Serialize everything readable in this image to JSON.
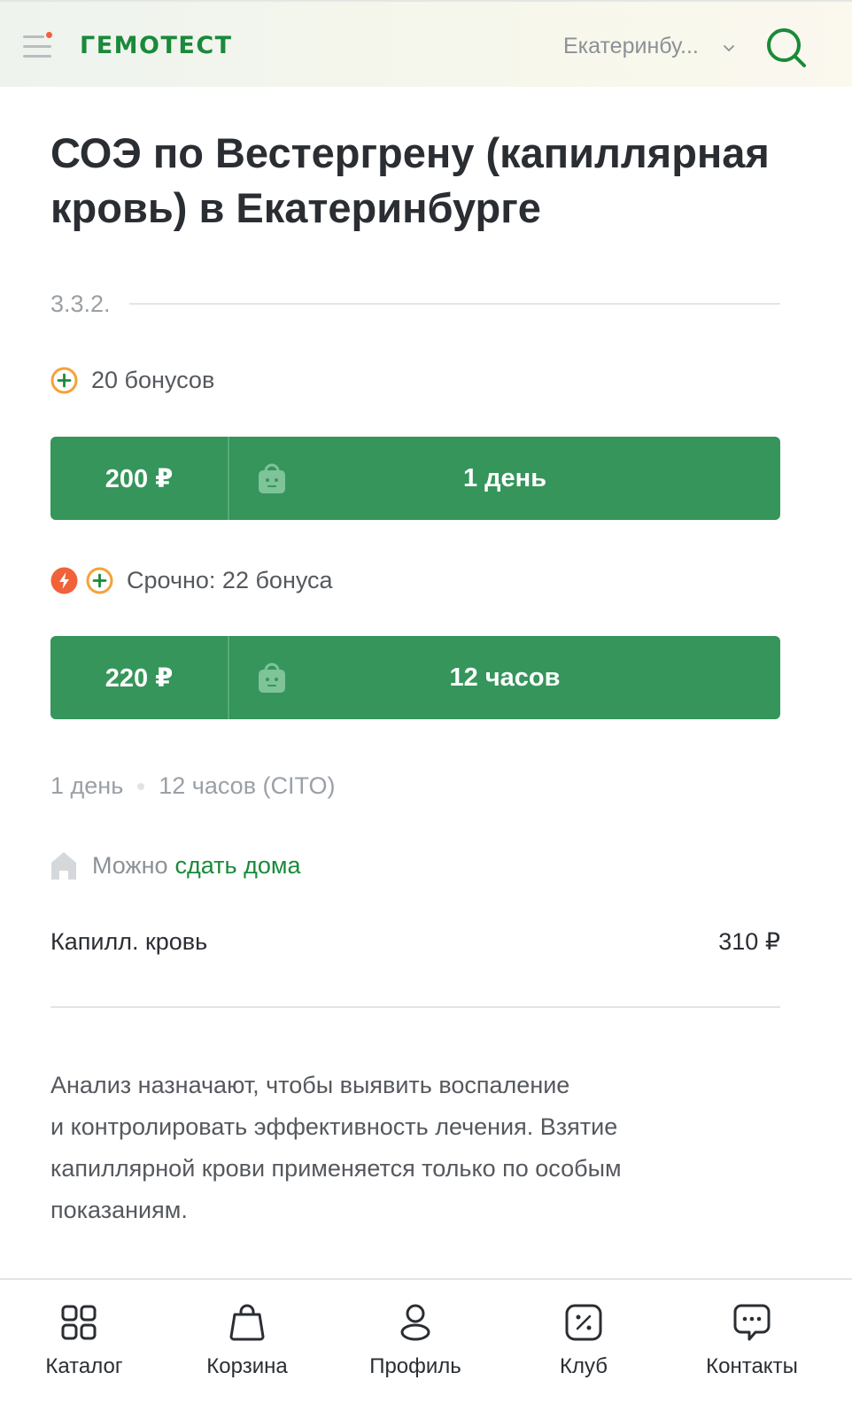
{
  "header": {
    "logo": "ГЕМОТЕСТ",
    "city": "Екатеринбу...",
    "colors": {
      "brand": "#1a8a3a",
      "notification_dot": "#f0623a"
    }
  },
  "test": {
    "title": "СОЭ по Вестергрену (капиллярная кровь) в Екатеринбурге",
    "code": "3.3.2."
  },
  "standard": {
    "bonus_text": "20 бонусов",
    "price": "200 ₽",
    "term": "1 день"
  },
  "urgent": {
    "bonus_text": "Срочно: 22 бонуса",
    "price": "220 ₽",
    "term": "12 часов"
  },
  "terms": {
    "normal": "1 день",
    "cito": "12 часов (CITO)"
  },
  "home": {
    "prefix": "Можно",
    "link": "сдать дома"
  },
  "capillary": {
    "label": "Капилл. кровь",
    "price": "310 ₽"
  },
  "description": {
    "lines": [
      "Анализ назначают, чтобы выявить воспаление",
      "и контролировать эффективность лечения. Взятие",
      "капиллярной крови применяется только по особым",
      "показаниям."
    ]
  },
  "bottom_nav": [
    {
      "label": "Каталог",
      "icon": "catalog-icon"
    },
    {
      "label": "Корзина",
      "icon": "cart-icon"
    },
    {
      "label": "Профиль",
      "icon": "profile-icon"
    },
    {
      "label": "Клуб",
      "icon": "club-icon"
    },
    {
      "label": "Контакты",
      "icon": "contacts-icon"
    }
  ],
  "colors": {
    "button_green": "#35955b",
    "bonus_orange": "#f5a23a",
    "urgent_orange": "#f0623a"
  }
}
